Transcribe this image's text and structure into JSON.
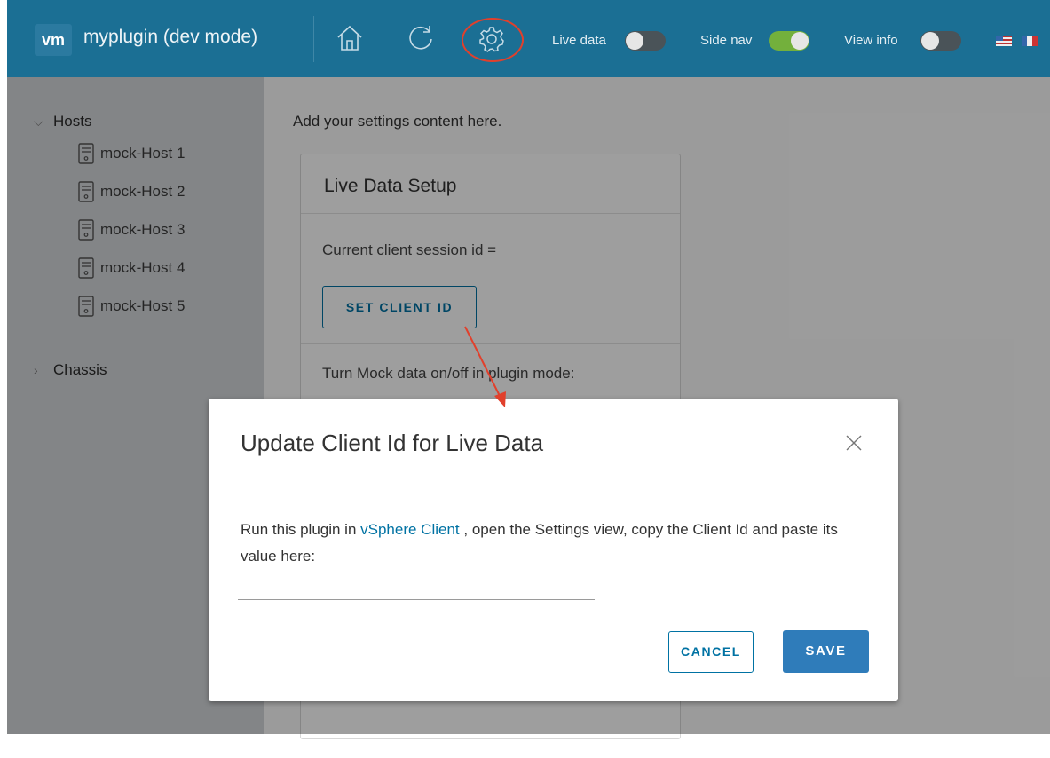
{
  "header": {
    "logo_text": "vm",
    "title": "myplugin (dev mode)",
    "icons": [
      "home-icon",
      "refresh-icon",
      "gear-icon"
    ],
    "toggles": [
      {
        "label": "Live data",
        "on": false
      },
      {
        "label": "Side nav",
        "on": true
      },
      {
        "label": "View info",
        "on": false
      }
    ],
    "colors": {
      "background": "#1b6f94",
      "toggle_on": "#73b03c",
      "highlight": "#e1402c"
    }
  },
  "sidenav": {
    "groups": [
      {
        "label": "Hosts",
        "expanded": true,
        "items": [
          "mock-Host 1",
          "mock-Host 2",
          "mock-Host 3",
          "mock-Host 4",
          "mock-Host 5"
        ]
      },
      {
        "label": "Chassis",
        "expanded": false
      }
    ]
  },
  "content": {
    "hint": "Add your settings content here.",
    "card": {
      "title": "Live Data Setup",
      "session_text": "Current client session id =",
      "set_button": "SET CLIENT ID",
      "mock_text": "Turn Mock data on/off in plugin mode:"
    }
  },
  "modal": {
    "title": "Update Client Id for Live Data",
    "body_prefix": "Run this plugin in ",
    "body_link": "vSphere Client",
    "body_suffix": " , open the Settings view, copy the Client Id and paste its value here:",
    "input_value": "",
    "cancel_label": "CANCEL",
    "save_label": "SAVE",
    "colors": {
      "primary": "#2f7cba",
      "link": "#0072a3"
    }
  }
}
